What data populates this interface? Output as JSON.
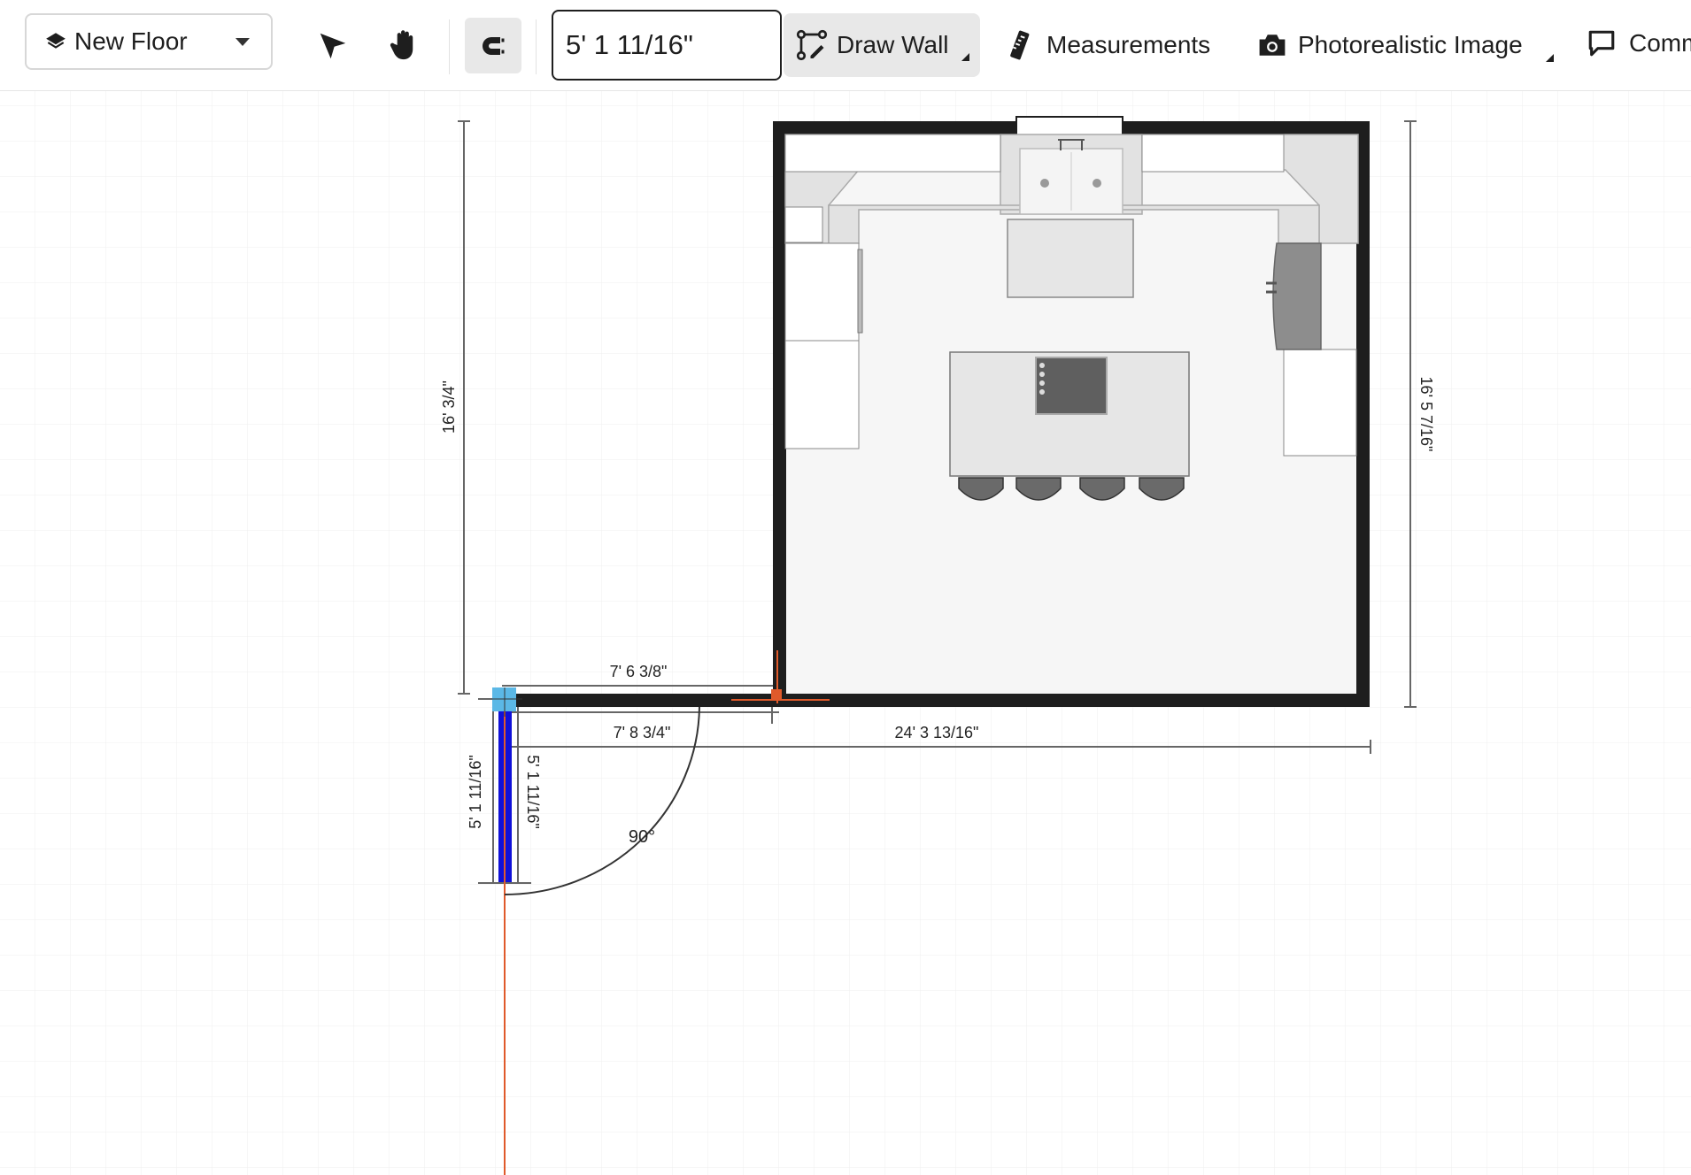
{
  "toolbar": {
    "floor_selector": {
      "label": "New Floor",
      "icon": "layers-icon"
    },
    "length_input": {
      "value": "5' 1 11/16\""
    },
    "draw_wall": {
      "label": "Draw Wall"
    },
    "measurements": {
      "label": "Measurements"
    },
    "photorealistic": {
      "label": "Photorealistic Image"
    },
    "comments": {
      "label": "Comm"
    }
  },
  "canvas": {
    "dimensions": {
      "left_height": "16' 3/4\"",
      "right_height": "16' 5 7/16\"",
      "top_wall": "7' 6 3/8\"",
      "bottom_wall": "7' 8 3/4\"",
      "total_width": "24' 3 13/16\"",
      "new_wall_left": "5' 1 11/16\"",
      "new_wall_right": "5' 1 11/16\"",
      "angle": "90°"
    }
  },
  "colors": {
    "wall": "#1e1e1e",
    "active_wall": "#1010d8",
    "guide": "#e05a2b",
    "node": "#5bb8e6",
    "grid": "#eeeeee"
  }
}
